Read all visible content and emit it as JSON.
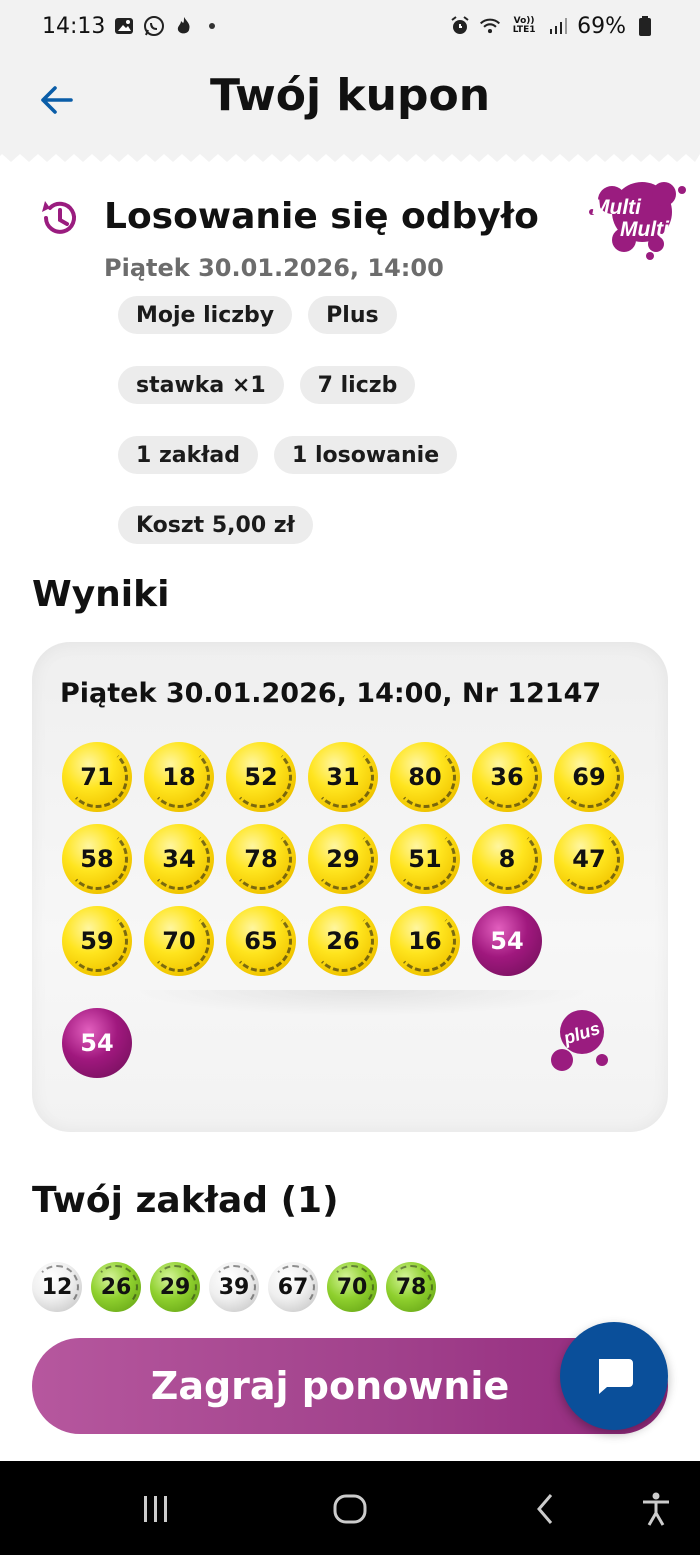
{
  "status_bar": {
    "time": "14:13",
    "network_label": "Vo)) LTE1",
    "battery": "69%"
  },
  "header": {
    "title": "Twój kupon",
    "back_icon": "arrow-left-icon"
  },
  "draw_info": {
    "status": "Losowanie się odbyło",
    "date": "Piątek 30.01.2026, 14:00",
    "brand": "Multi Multi",
    "chips": [
      "Moje liczby",
      "Plus",
      "stawka ×1",
      "7 liczb",
      "1 zakład",
      "1 losowanie",
      "Koszt 5,00 zł"
    ]
  },
  "results": {
    "section_title": "Wyniki",
    "draw_line": "Piątek 30.01.2026, 14:00, Nr 12147",
    "numbers": [
      "71",
      "18",
      "52",
      "31",
      "80",
      "36",
      "69",
      "58",
      "34",
      "78",
      "29",
      "51",
      "8",
      "47",
      "59",
      "70",
      "65",
      "26",
      "16"
    ],
    "plus_in_grid": "54",
    "plus_number": "54",
    "plus_logo_text": "plus"
  },
  "bet": {
    "section_title": "Twój zakład (1)",
    "numbers": [
      {
        "value": "12",
        "hit": false
      },
      {
        "value": "26",
        "hit": true
      },
      {
        "value": "29",
        "hit": true
      },
      {
        "value": "39",
        "hit": false
      },
      {
        "value": "67",
        "hit": false
      },
      {
        "value": "70",
        "hit": true
      },
      {
        "value": "78",
        "hit": true
      }
    ]
  },
  "actions": {
    "play_again": "Zagraj ponownie",
    "chat_icon": "chat-bubble-icon"
  },
  "colors": {
    "accent_blue": "#0a4f9a",
    "brand_purple": "#a1428c",
    "ball_yellow": "#ffe51f",
    "ball_green": "#8fd02e"
  }
}
